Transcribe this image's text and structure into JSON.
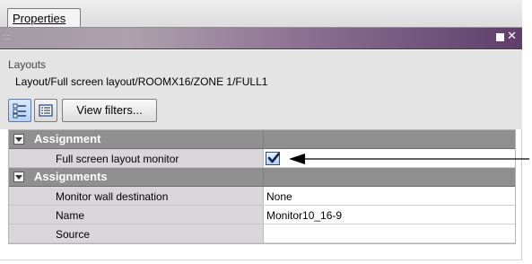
{
  "tabs": [
    {
      "label": "Properties",
      "active": true
    }
  ],
  "window": {
    "grip_glyph": "⁚⁚⁚⁚",
    "maximize_icon": "square-icon",
    "close_glyph": "✕"
  },
  "info": {
    "title": "Layouts",
    "path": "Layout/Full screen layout/ROOMX16/ZONE 1/FULL1"
  },
  "toolbar": {
    "categorized_icon": "categorized-view-icon",
    "list_icon": "list-view-icon",
    "view_filters_label": "View filters..."
  },
  "property_grid": {
    "groups": [
      {
        "name": "Assignment",
        "expanded": true,
        "properties": [
          {
            "label": "Full screen layout monitor",
            "value": "",
            "type": "checkbox",
            "checked": true
          }
        ]
      },
      {
        "name": "Assignments",
        "expanded": true,
        "properties": [
          {
            "label": "Monitor wall destination",
            "value": "None",
            "type": "text"
          },
          {
            "label": "Name",
            "value": "Monitor10_16-9",
            "type": "text"
          },
          {
            "label": "Source",
            "value": "",
            "type": "text"
          }
        ]
      }
    ]
  },
  "colors": {
    "titlebar_start": "#a39aa6",
    "titlebar_end": "#5f3f6a",
    "category_row": "#8f8f8f",
    "property_label_bg": "#d9d6d9",
    "panel_bg": "#e4e4e4"
  }
}
